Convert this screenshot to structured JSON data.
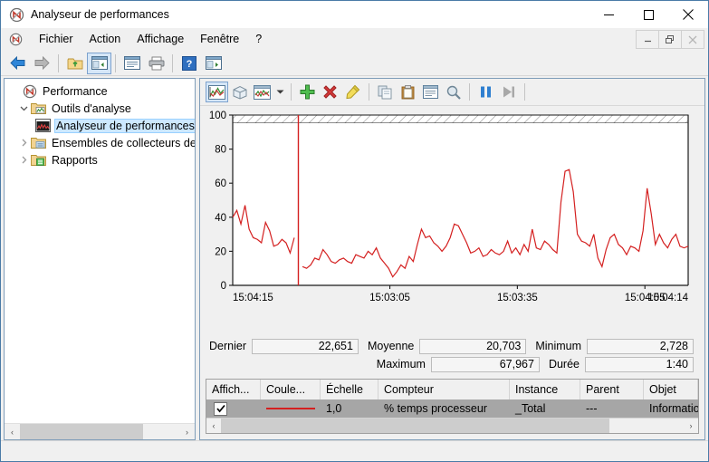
{
  "window": {
    "title": "Analyseur de performances",
    "app_icon": "perfmon-icon",
    "minimize_label": "—",
    "maximize_label": "□",
    "close_label": "✕"
  },
  "mdi_controls": {
    "minimize_label": "—",
    "restore_label": "❐",
    "close_label": "✕"
  },
  "menubar": {
    "icon": "perfmon-icon",
    "items": [
      {
        "label": "Fichier"
      },
      {
        "label": "Action"
      },
      {
        "label": "Affichage"
      },
      {
        "label": "Fenêtre"
      },
      {
        "label": "?"
      }
    ]
  },
  "toolbar": {
    "buttons": [
      {
        "name": "back-icon",
        "tip": "Précédent",
        "selected": false
      },
      {
        "name": "forward-icon",
        "tip": "Suivant",
        "selected": false
      },
      {
        "name": "up-folder-icon",
        "tip": "Remonter d'un niveau",
        "selected": false
      },
      {
        "name": "show-console-tree-icon",
        "tip": "Afficher/Masquer l'arborescence",
        "selected": true
      },
      {
        "name": "properties-icon",
        "tip": "Propriétés",
        "selected": false
      },
      {
        "name": "print-icon",
        "tip": "Imprimer",
        "selected": false
      },
      {
        "name": "help-icon",
        "tip": "Aide",
        "selected": false
      },
      {
        "name": "new-window-icon",
        "tip": "Nouvelle fenêtre",
        "selected": false
      }
    ]
  },
  "tree": {
    "items": [
      {
        "label": "Performance",
        "icon": "perfmon-icon",
        "arrow": "",
        "depth": 0,
        "selected": false
      },
      {
        "label": "Outils d'analyse",
        "icon": "folder-chart-icon",
        "arrow": "⌄",
        "depth": 1,
        "selected": false
      },
      {
        "label": "Analyseur de performances",
        "icon": "perf-monitor-icon",
        "arrow": "",
        "depth": 2,
        "selected": true
      },
      {
        "label": "Ensembles de collecteurs de don",
        "icon": "folder-collector-icon",
        "arrow": "›",
        "depth": 1,
        "selected": false
      },
      {
        "label": "Rapports",
        "icon": "folder-report-icon",
        "arrow": "›",
        "depth": 1,
        "selected": false
      }
    ],
    "scroll_left_label": "‹",
    "scroll_right_label": "›"
  },
  "chart_toolbar": {
    "buttons": [
      {
        "name": "view-graph-icon",
        "tip": "Afficher le graphique",
        "selected": true
      },
      {
        "name": "view-3d-icon",
        "tip": "Vue histogramme",
        "selected": false
      },
      {
        "name": "change-graph-type-icon",
        "tip": "Modifier le type de graphique",
        "selected": false
      },
      {
        "name": "chevron-down-icon",
        "tip": "Types de graphique",
        "selected": false
      },
      {
        "name": "add-counter-icon",
        "tip": "Ajouter",
        "selected": false
      },
      {
        "name": "delete-counter-icon",
        "tip": "Supprimer",
        "selected": false
      },
      {
        "name": "highlight-icon",
        "tip": "Surbrillance",
        "selected": false
      },
      {
        "name": "copy-icon",
        "tip": "Copier",
        "selected": false
      },
      {
        "name": "paste-icon",
        "tip": "Coller",
        "selected": false
      },
      {
        "name": "graph-properties-icon",
        "tip": "Propriétés",
        "selected": false
      },
      {
        "name": "zoom-icon",
        "tip": "Zoom",
        "selected": false
      },
      {
        "name": "freeze-icon",
        "tip": "Figer l'affichage",
        "selected": false
      },
      {
        "name": "update-icon",
        "tip": "Mettre à jour les données",
        "selected": false
      }
    ]
  },
  "stats": {
    "dernier_label": "Dernier",
    "dernier_value": "22,651",
    "moyenne_label": "Moyenne",
    "moyenne_value": "20,703",
    "minimum_label": "Minimum",
    "minimum_value": "2,728",
    "maximum_label": "Maximum",
    "maximum_value": "67,967",
    "duree_label": "Durée",
    "duree_value": "1:40"
  },
  "counter_table": {
    "headers": [
      "Affich...",
      "Coule...",
      "Échelle",
      "Compteur",
      "Instance",
      "Parent",
      "Objet"
    ],
    "rows": [
      {
        "shown": true,
        "color": "#d42020",
        "scale": "1,0",
        "counter": "% temps processeur",
        "instance": "_Total",
        "parent": "---",
        "object": "Informations sur le p",
        "selected": true
      }
    ],
    "scroll_left_label": "‹",
    "scroll_right_label": "›"
  },
  "statusbar": {
    "text": ""
  },
  "chart_data": {
    "type": "line",
    "title": "",
    "xlabel": "",
    "ylabel": "",
    "ylim": [
      0,
      100
    ],
    "yticks": [
      0,
      20,
      40,
      60,
      80,
      100
    ],
    "xticks": [
      "15:04:15",
      "15:03:05",
      "15:03:35",
      "15:04:05",
      "15:04:14"
    ],
    "grid": false,
    "legend": "none",
    "line_color": "#d42020",
    "cursor_color": "#d42020",
    "cursor_index": 15,
    "series": [
      {
        "name": "% temps processeur",
        "values": [
          40,
          44,
          36,
          47,
          33,
          28,
          27,
          25,
          37,
          32,
          23,
          24,
          27,
          25,
          19,
          28,
          null,
          11,
          10,
          12,
          16,
          15,
          21,
          18,
          14,
          13,
          15,
          16,
          14,
          13,
          18,
          17,
          16,
          20,
          18,
          22,
          16,
          13,
          10,
          5,
          8,
          12,
          10,
          17,
          14,
          24,
          33,
          28,
          29,
          25,
          23,
          20,
          23,
          28,
          36,
          35,
          30,
          25,
          19,
          20,
          22,
          17,
          18,
          21,
          19,
          18,
          20,
          26,
          19,
          22,
          18,
          24,
          20,
          33,
          22,
          21,
          26,
          24,
          21,
          19,
          49,
          67,
          68,
          55,
          30,
          26,
          25,
          23,
          30,
          16,
          11,
          21,
          28,
          30,
          24,
          22,
          18,
          23,
          22,
          20,
          32,
          57,
          42,
          24,
          30,
          25,
          22,
          27,
          30,
          23,
          22,
          23
        ]
      }
    ]
  }
}
